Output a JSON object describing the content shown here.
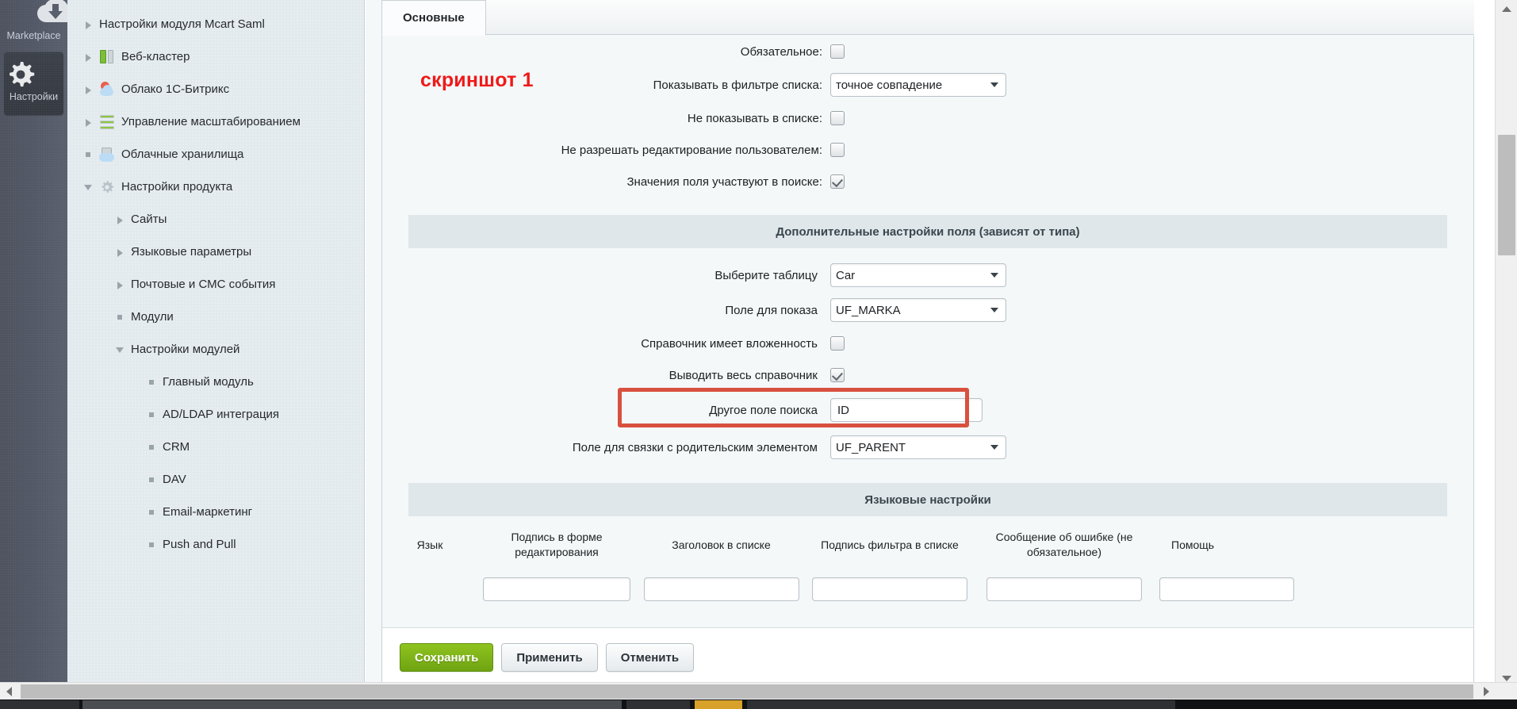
{
  "rail": {
    "items": [
      {
        "label": "Marketplace",
        "icon": "cloud-download-icon",
        "active": false
      },
      {
        "label": "Настройки",
        "icon": "gear-icon",
        "active": true
      }
    ]
  },
  "tree": {
    "items": [
      {
        "label": "Настройки модуля Mcart Saml",
        "twisty": "arrow-right",
        "icon": "none",
        "indent": 0
      },
      {
        "label": "Веб-кластер",
        "twisty": "arrow-right",
        "icon": "server-icon",
        "indent": 0
      },
      {
        "label": "Облако 1С-Битрикс",
        "twisty": "arrow-right",
        "icon": "cloud-1c-icon",
        "indent": 0
      },
      {
        "label": "Управление масштабированием",
        "twisty": "arrow-right",
        "icon": "scaling-icon",
        "indent": 0
      },
      {
        "label": "Облачные хранилища",
        "twisty": "dot",
        "icon": "cloud-storage-icon",
        "indent": 0
      },
      {
        "label": "Настройки продукта",
        "twisty": "arrow-down",
        "icon": "gear-small-icon",
        "indent": 0
      },
      {
        "label": "Сайты",
        "twisty": "arrow-right",
        "icon": "none",
        "indent": 1
      },
      {
        "label": "Языковые параметры",
        "twisty": "arrow-right",
        "icon": "none",
        "indent": 1
      },
      {
        "label": "Почтовые и СМС события",
        "twisty": "arrow-right",
        "icon": "none",
        "indent": 1
      },
      {
        "label": "Модули",
        "twisty": "dot",
        "icon": "none",
        "indent": 1
      },
      {
        "label": "Настройки модулей",
        "twisty": "arrow-down",
        "icon": "none",
        "indent": 1
      },
      {
        "label": "Главный модуль",
        "twisty": "dot",
        "icon": "none",
        "indent": 2
      },
      {
        "label": "AD/LDAP интеграция",
        "twisty": "dot",
        "icon": "none",
        "indent": 2
      },
      {
        "label": "CRM",
        "twisty": "dot",
        "icon": "none",
        "indent": 2
      },
      {
        "label": "DAV",
        "twisty": "dot",
        "icon": "none",
        "indent": 2
      },
      {
        "label": "Email-маркетинг",
        "twisty": "dot",
        "icon": "none",
        "indent": 2
      },
      {
        "label": "Push and Pull",
        "twisty": "dot",
        "icon": "none",
        "indent": 2
      }
    ]
  },
  "tabs": [
    {
      "label": "Основные",
      "active": true
    }
  ],
  "annotation": {
    "text": "скриншот 1",
    "color": "#ef1a1a"
  },
  "form": {
    "rows": [
      {
        "label": "Обязательное:",
        "type": "checkbox",
        "checked": false
      },
      {
        "label": "Показывать в фильтре списка:",
        "type": "select",
        "value": "точное совпадение",
        "options": [
          "точное совпадение"
        ]
      },
      {
        "label": "Не показывать в списке:",
        "type": "checkbox",
        "checked": false
      },
      {
        "label": "Не разрешать редактирование пользователем:",
        "type": "checkbox",
        "checked": false
      },
      {
        "label": "Значения поля участвуют в поиске:",
        "type": "checkbox",
        "checked": true
      }
    ]
  },
  "section_extra": {
    "title": "Дополнительные настройки поля (зависят от типа)",
    "rows": [
      {
        "label": "Выберите таблицу",
        "type": "select",
        "value": "Car",
        "options": [
          "Car"
        ]
      },
      {
        "label": "Поле для показа",
        "type": "select",
        "value": "UF_MARKA",
        "options": [
          "UF_MARKA"
        ]
      },
      {
        "label": "Справочник имеет вложенность",
        "type": "checkbox",
        "checked": false
      },
      {
        "label": "Выводить весь справочник",
        "type": "checkbox",
        "checked": true
      },
      {
        "label": "Другое поле поиска",
        "type": "text",
        "value": "ID",
        "highlighted": true
      },
      {
        "label": "Поле для связки с родительским элементом",
        "type": "select",
        "value": "UF_PARENT",
        "options": [
          "UF_PARENT"
        ]
      }
    ]
  },
  "section_lang": {
    "title": "Языковые настройки",
    "columns": [
      "Язык",
      "Подпись в форме редактирования",
      "Заголовок в списке",
      "Подпись фильтра в списке",
      "Сообщение об ошибке (не обязательное)",
      "Помощь"
    ],
    "rows": [
      {
        "lang": "",
        "edit_caption": "",
        "list_header": "",
        "list_filter": "",
        "error_message": "",
        "help": ""
      }
    ]
  },
  "footer": {
    "save": "Сохранить",
    "apply": "Применить",
    "cancel": "Отменить"
  },
  "colors": {
    "accent_red": "#d9503f",
    "save_green": "#7fb315",
    "panel_bg": "#f4f8f9",
    "tree_bg": "#e3eaee",
    "rail_bg": "#545966"
  }
}
